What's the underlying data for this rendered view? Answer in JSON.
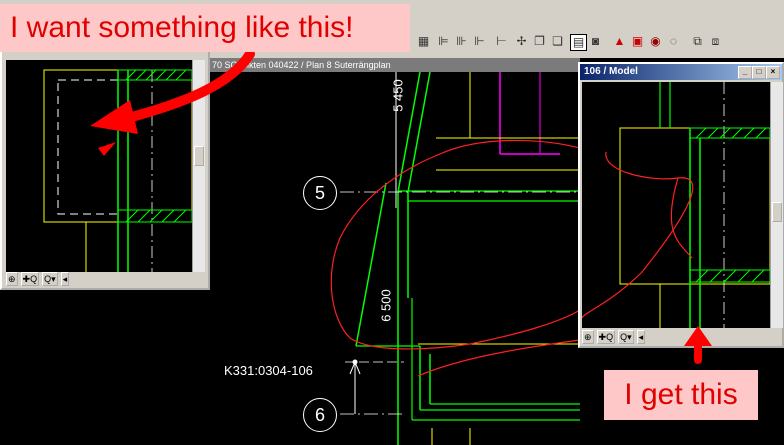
{
  "main_window": {
    "title": "70 SO tsikten 040422 / Plan 8 Suterrängplan",
    "dimensions": [
      "5 450",
      "6 500"
    ],
    "axis_labels": [
      "5",
      "6"
    ],
    "tag": "K331:0304-106"
  },
  "left_window": {
    "zoom_controls": [
      "⊕",
      "✚Q",
      "Q▾",
      "◂"
    ]
  },
  "right_window": {
    "title": "106 / Model",
    "controls": [
      "_",
      "□",
      "×"
    ],
    "zoom_controls": [
      "⊕",
      "✚Q",
      "Q▾",
      "◂"
    ]
  },
  "annotations": {
    "left": "I want something like this!",
    "right": "I get this"
  },
  "toolbar": {
    "icons": [
      "grid-icon",
      "align-icon",
      "align-icon",
      "align-icon",
      "measure-icon",
      "copy-icon",
      "paste-icon",
      "document-icon",
      "select-icon",
      "camera-icon",
      "paint-icon",
      "print-icon",
      "zoom-icon",
      "zoom-out-icon",
      "window-icon",
      "window-icon"
    ]
  },
  "colors": {
    "drawing_green": "#00ff00",
    "drawing_yellow": "#ffff00",
    "drawing_magenta": "#ff00ff",
    "sketch_red": "#ff2020",
    "callout_bg": "#ffc8c8",
    "callout_text": "#e00000"
  }
}
